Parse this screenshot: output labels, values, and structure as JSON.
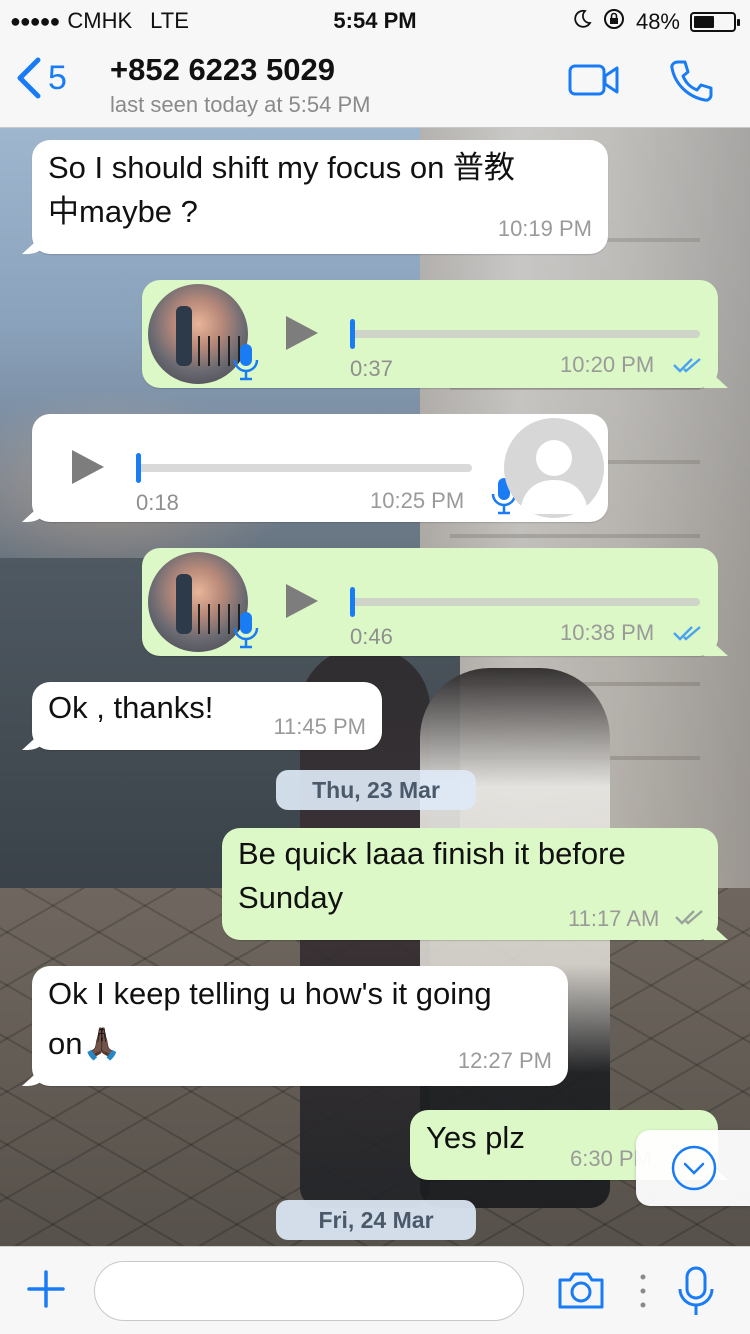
{
  "status_bar": {
    "signal_dots": "●●●●●",
    "carrier": "CMHK",
    "network": "LTE",
    "time": "5:54 PM",
    "battery_percent": "48%",
    "battery_level": 0.48
  },
  "header": {
    "back_count": "5",
    "contact_name": "+852 6223 5029",
    "last_seen": "last seen today at 5:54 PM"
  },
  "messages": [
    {
      "direction": "in",
      "type": "text",
      "text_line1": "So I should shift my focus on 普教",
      "text_line2": "中maybe ?",
      "time": "10:19 PM"
    },
    {
      "direction": "out",
      "type": "voice",
      "duration": "0:37",
      "time": "10:20 PM",
      "status": "read"
    },
    {
      "direction": "in",
      "type": "voice",
      "duration": "0:18",
      "time": "10:25 PM"
    },
    {
      "direction": "out",
      "type": "voice",
      "duration": "0:46",
      "time": "10:38 PM",
      "status": "read"
    },
    {
      "direction": "in",
      "type": "text",
      "text_line1": "Ok , thanks!",
      "time": "11:45 PM"
    },
    {
      "direction": "out",
      "type": "text",
      "text_line1": "Be quick laaa finish it before",
      "text_line2": "Sunday",
      "time": "11:17 AM",
      "status": "delivered"
    },
    {
      "direction": "in",
      "type": "text",
      "text_line1": "Ok I keep telling u how's it going",
      "text_line2": "on🙏🏿",
      "time": "12:27 PM"
    },
    {
      "direction": "out",
      "type": "text",
      "text_line1": "Yes plz",
      "time": "6:30 PM"
    }
  ],
  "date_separators": [
    "Thu, 23 Mar",
    "Fri, 24 Mar"
  ],
  "composer": {
    "value": "",
    "placeholder": ""
  },
  "colors": {
    "accent": "#1a7cf5",
    "outgoing_bubble": "#dcf8c6",
    "incoming_bubble": "#ffffff"
  },
  "icons": [
    "back-chevron-icon",
    "video-call-icon",
    "phone-icon",
    "play-icon",
    "microphone-icon",
    "read-ticks-icon",
    "chevron-down-icon",
    "plus-icon",
    "camera-icon",
    "more-dots-icon"
  ]
}
